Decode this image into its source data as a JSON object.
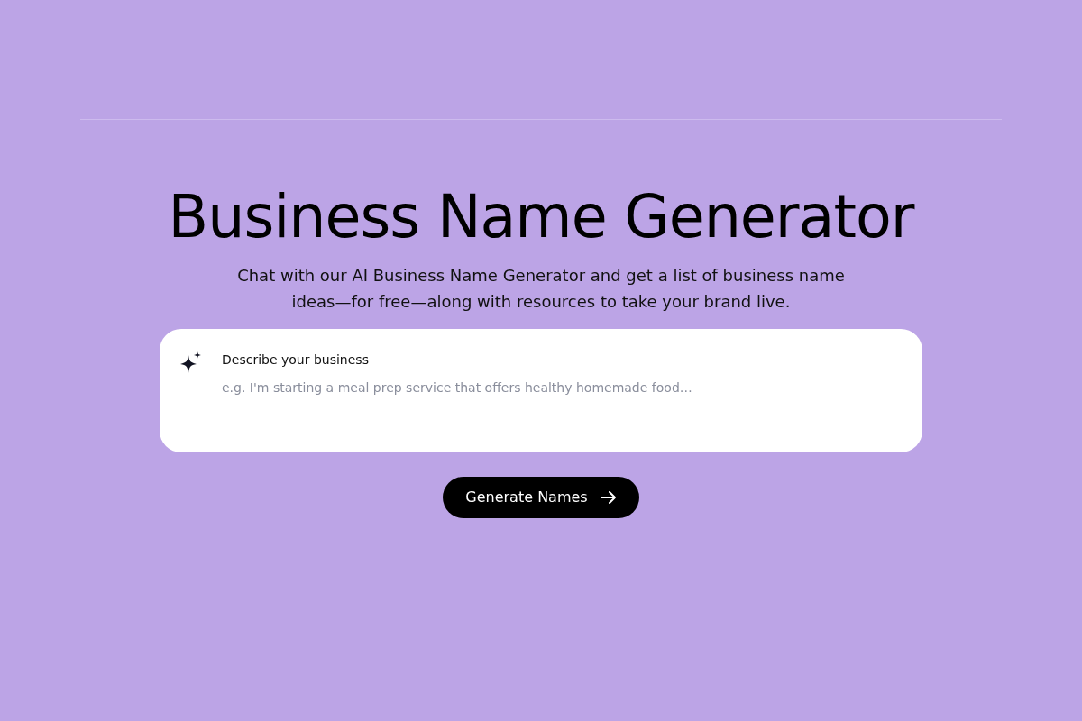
{
  "title": "Business Name Generator",
  "subtitle": "Chat with our AI Business Name Generator and get a list of business name ideas—for free—along with resources to take your brand live.",
  "prompt": {
    "label": "Describe your business",
    "placeholder": "e.g. I'm starting a meal prep service that offers healthy homemade food…"
  },
  "button": {
    "label": "Generate Names"
  }
}
